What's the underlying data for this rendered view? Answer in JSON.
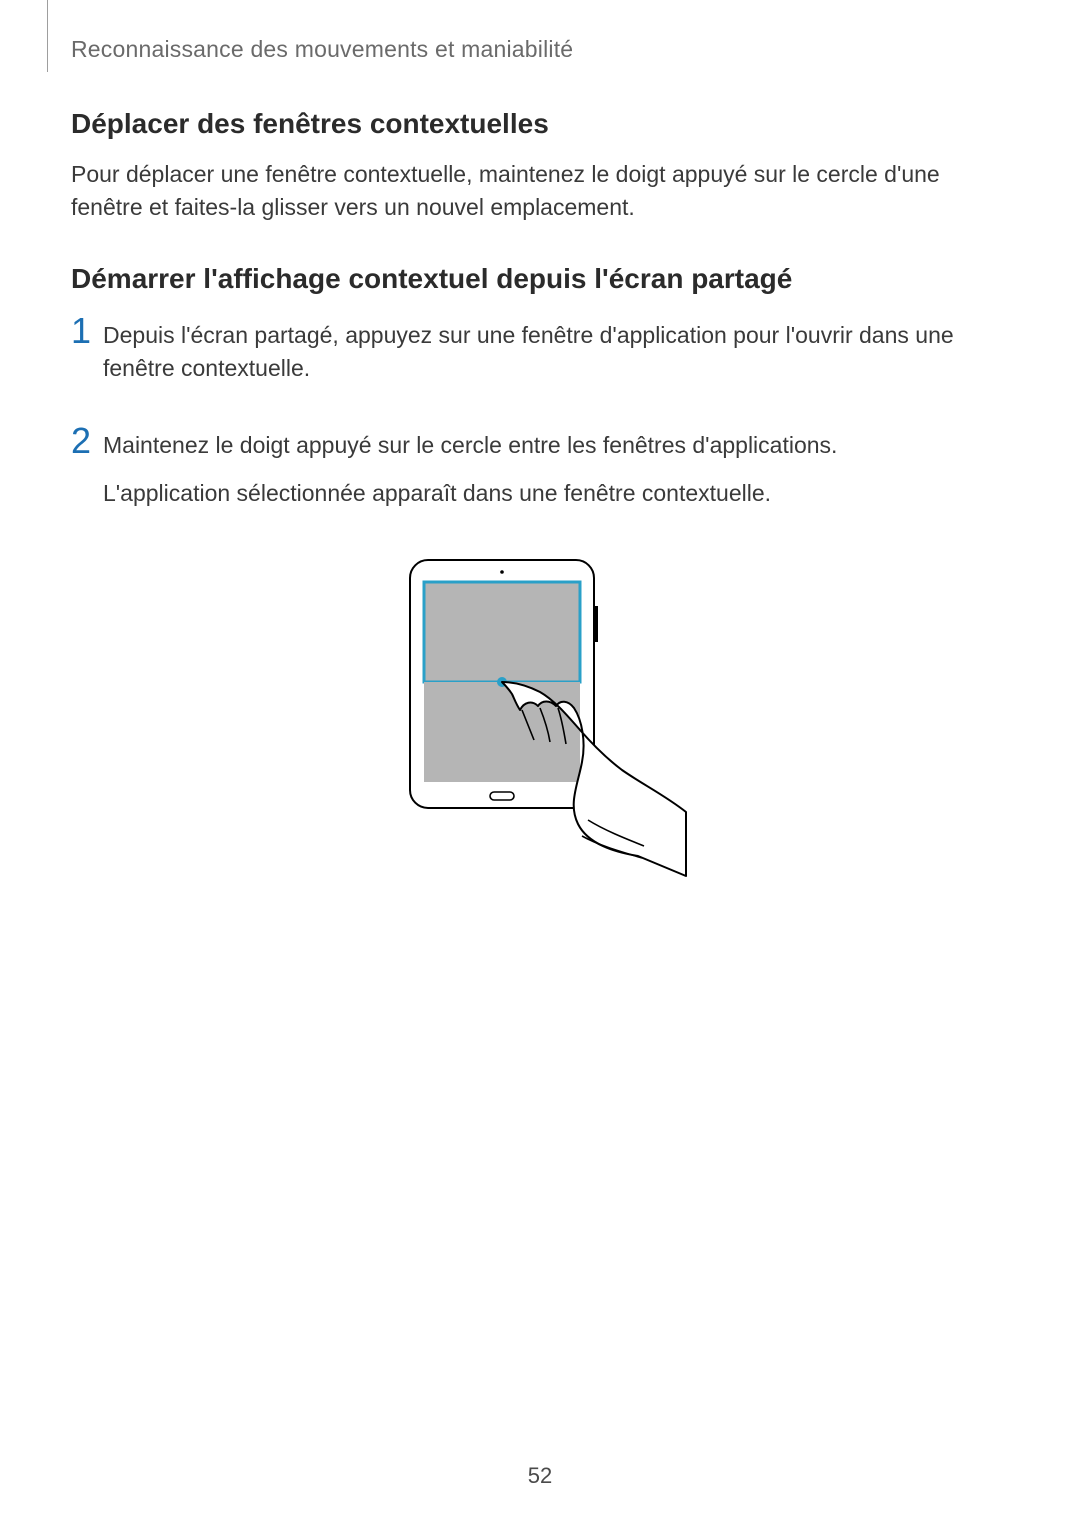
{
  "running_header": "Reconnaissance des mouvements et maniabilité",
  "section1": {
    "heading": "Déplacer des fenêtres contextuelles",
    "body": "Pour déplacer une fenêtre contextuelle, maintenez le doigt appuyé sur le cercle d'une fenêtre et faites-la glisser vers un nouvel emplacement."
  },
  "section2": {
    "heading": "Démarrer l'affichage contextuel depuis l'écran partagé",
    "steps": [
      {
        "num": "1",
        "lines": [
          "Depuis l'écran partagé, appuyez sur une fenêtre d'application pour l'ouvrir dans une fenêtre contextuelle."
        ]
      },
      {
        "num": "2",
        "lines": [
          "Maintenez le doigt appuyé sur le cercle entre les fenêtres d'applications.",
          "L'application sélectionnée apparaît dans une fenêtre contextuelle."
        ]
      }
    ]
  },
  "page_number": "52"
}
